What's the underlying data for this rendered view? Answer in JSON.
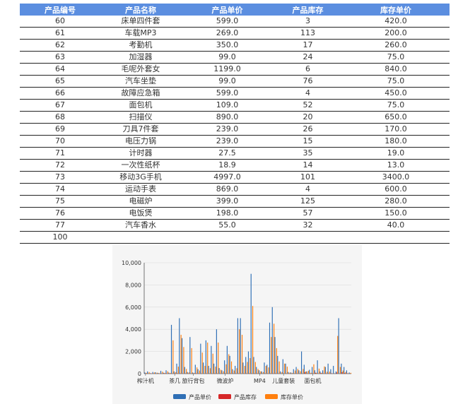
{
  "table": {
    "columns": [
      "产品编号",
      "产品名称",
      "产品单价",
      "产品库存",
      "库存单价"
    ],
    "rows": [
      [
        "60",
        "床单四件套",
        "599.0",
        "3",
        "420.0"
      ],
      [
        "61",
        "车载MP3",
        "269.0",
        "113",
        "200.0"
      ],
      [
        "62",
        "考勤机",
        "350.0",
        "17",
        "260.0"
      ],
      [
        "63",
        "加湿器",
        "99.0",
        "24",
        "75.0"
      ],
      [
        "64",
        "毛呢外套女",
        "1199.0",
        "6",
        "840.0"
      ],
      [
        "65",
        "汽车坐垫",
        "99.0",
        "76",
        "75.0"
      ],
      [
        "66",
        "故障应急箱",
        "599.0",
        "4",
        "450.0"
      ],
      [
        "67",
        "面包机",
        "109.0",
        "52",
        "75.0"
      ],
      [
        "68",
        "扫描仪",
        "890.0",
        "20",
        "650.0"
      ],
      [
        "69",
        "刀具7件套",
        "239.0",
        "26",
        "170.0"
      ],
      [
        "70",
        "电压力锅",
        "239.0",
        "15",
        "180.0"
      ],
      [
        "71",
        "计时器",
        "27.5",
        "35",
        "19.0"
      ],
      [
        "72",
        "一次性纸杯",
        "18.9",
        "14",
        "13.0"
      ],
      [
        "73",
        "移动3G手机",
        "4997.0",
        "101",
        "3400.0"
      ],
      [
        "74",
        "运动手表",
        "869.0",
        "4",
        "600.0"
      ],
      [
        "75",
        "电磁炉",
        "399.0",
        "125",
        "280.0"
      ],
      [
        "76",
        "电饭煲",
        "198.0",
        "57",
        "150.0"
      ],
      [
        "77",
        "汽车香水",
        "55.0",
        "32",
        "40.0"
      ],
      [
        "100",
        "",
        "",
        "",
        ""
      ]
    ]
  },
  "chart_data": {
    "type": "bar",
    "ylim": [
      0,
      10000
    ],
    "yticks": [
      "0",
      "2,000",
      "4,000",
      "6,000",
      "8,000",
      "10,000"
    ],
    "category_labels": [
      "榨汁机",
      "茶几",
      "旅行背包",
      "微波炉",
      "MP4",
      "儿童套装",
      "面包机"
    ],
    "category_label_positions": [
      0,
      11,
      18,
      30,
      43,
      52,
      63
    ],
    "count": 78,
    "series": [
      {
        "name": "产品单价",
        "color": "#2f6fb5",
        "values": [
          99,
          200,
          40,
          150,
          120,
          60,
          250,
          80,
          300,
          90,
          4400,
          200,
          900,
          5000,
          3200,
          600,
          150,
          3300,
          100,
          800,
          400,
          2700,
          1000,
          3000,
          700,
          2500,
          900,
          4000,
          500,
          300,
          1200,
          2500,
          1600,
          400,
          700,
          5000,
          5000,
          1000,
          1500,
          2000,
          9000,
          1500,
          600,
          300,
          200,
          1000,
          800,
          4600,
          6000,
          3300,
          1600,
          200,
          1300,
          900,
          150,
          100,
          400,
          600,
          300,
          2000,
          800,
          200,
          350,
          600,
          300,
          1200,
          200,
          300,
          600,
          900,
          400,
          700,
          200,
          5000,
          900,
          600,
          300,
          100
        ]
      },
      {
        "name": "产品库存",
        "color": "#d62728",
        "values": [
          20,
          10,
          30,
          15,
          5,
          12,
          8,
          40,
          20,
          15,
          10,
          30,
          25,
          18,
          12,
          10,
          22,
          8,
          14,
          30,
          12,
          16,
          10,
          20,
          9,
          15,
          18,
          12,
          10,
          8,
          6,
          14,
          20,
          12,
          9,
          15,
          10,
          25,
          18,
          30,
          12,
          20,
          15,
          10,
          8,
          12,
          10,
          14,
          20,
          30,
          12,
          10,
          8,
          15,
          20,
          10,
          12,
          18,
          9,
          3,
          113,
          17,
          24,
          6,
          76,
          4,
          52,
          20,
          26,
          15,
          35,
          14,
          101,
          4,
          125,
          57,
          32,
          10
        ]
      },
      {
        "name": "库存单价",
        "color": "#ff7f0e",
        "values": [
          70,
          140,
          28,
          105,
          85,
          42,
          175,
          56,
          210,
          63,
          3000,
          140,
          630,
          3500,
          2400,
          420,
          105,
          2300,
          70,
          560,
          280,
          1900,
          700,
          2800,
          490,
          1800,
          630,
          2800,
          350,
          210,
          840,
          1750,
          1100,
          280,
          490,
          4000,
          3500,
          700,
          1050,
          1400,
          6100,
          1050,
          420,
          210,
          140,
          700,
          560,
          3300,
          4500,
          2300,
          1100,
          140,
          900,
          630,
          105,
          70,
          280,
          420,
          210,
          420,
          200,
          260,
          75,
          840,
          75,
          450,
          75,
          650,
          170,
          180,
          19,
          13,
          3400,
          600,
          280,
          150,
          40,
          70
        ]
      }
    ]
  }
}
